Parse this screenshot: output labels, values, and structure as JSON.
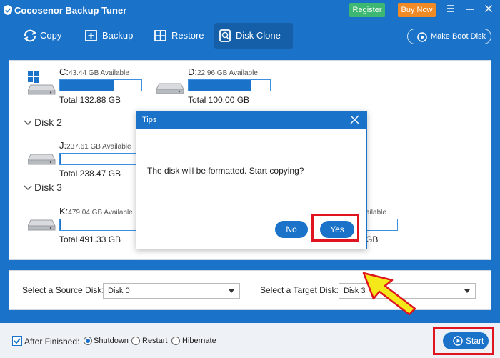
{
  "app": {
    "title": "Cocosenor Backup Tuner",
    "register": "Register",
    "buy_now": "Buy Now"
  },
  "toolbar": {
    "copy": "Copy",
    "backup": "Backup",
    "restore": "Restore",
    "disk_clone": "Disk Clone",
    "make_boot_disk": "Make Boot Disk"
  },
  "disks": {
    "disk1": {
      "drives": [
        {
          "letter": "C:",
          "available": "43.44 GB Available",
          "total": "Total 132.88 GB",
          "used_fraction": 0.67
        },
        {
          "letter": "D:",
          "available": "22.96 GB Available",
          "total": "Total 100.00 GB",
          "used_fraction": 0.77
        }
      ]
    },
    "disk2": {
      "label": "Disk 2",
      "drives": [
        {
          "letter": "J:",
          "available": "237.61 GB Available",
          "total": "Total 238.47 GB",
          "used_fraction": 0.01
        }
      ]
    },
    "disk3": {
      "label": "Disk 3",
      "drives": [
        {
          "letter": "K:",
          "available": "479.04 GB Available",
          "total": "Total 491.33 GB",
          "used_fraction": 0.02
        },
        {
          "available_suffix": "ailable",
          "total_suffix": "GB"
        }
      ]
    }
  },
  "selection": {
    "source_label": "Select a Source Disk:",
    "source_value": "Disk 0",
    "target_label": "Select a Target Disk:",
    "target_value": "Disk 3"
  },
  "footer": {
    "after_finished": "After Finished:",
    "options": [
      "Shutdown",
      "Restart",
      "Hibernate"
    ],
    "selected": "Shutdown",
    "start": "Start"
  },
  "dialog": {
    "title": "Tips",
    "message": "The disk will be formatted. Start copying?",
    "no": "No",
    "yes": "Yes"
  },
  "colors": {
    "primary": "#1a73c9",
    "register": "#3cb873",
    "buy_now": "#f08a24",
    "highlight": "#e0141e",
    "arrow": "#f5e81a"
  }
}
